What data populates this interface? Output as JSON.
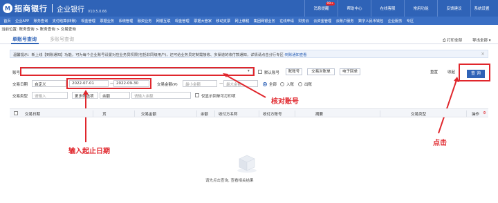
{
  "header": {
    "logo_mark": "M",
    "bank_name": "招商银行",
    "app_name": "企业银行",
    "version": "V10.5.0.66"
  },
  "util_links": [
    {
      "label": "消息提醒",
      "badge": "99+"
    },
    {
      "label": "帮助中心",
      "badge": ""
    },
    {
      "label": "在线客服",
      "badge": ""
    },
    {
      "label": "常用功能",
      "badge": ""
    },
    {
      "label": "反馈建议",
      "badge": ""
    },
    {
      "label": "系统设置",
      "badge": ""
    },
    {
      "label": "安全退出",
      "badge": ""
    }
  ],
  "nav": [
    "首页",
    "企业APP",
    "账务查询",
    "支付结算(转账)",
    "现金管理",
    "票据业务",
    "系统管理",
    "融资业务",
    "网银互联",
    "现金管理",
    "票据大管家",
    "移动支票",
    "网上缴税",
    "集团网银业务",
    "在线申请",
    "财务云",
    "云资金管理",
    "云账户服务",
    "数字人民币钱包",
    "企业服务",
    "专区",
    "购物"
  ],
  "breadcrumb": "当前位置: 账务查询 > 账务查询 > 交易查询",
  "tabs": {
    "active": "单账号查询",
    "inactive": "多账号查询"
  },
  "print_all": "打印全部",
  "export_all": "导出全部",
  "notice": {
    "prefix": "温馨提示：",
    "text": "新上线【到账通知】功能，可为每个企业账号设置对应业务员权限(包括非同级用户)，还可给业务员定制需接收、多渠道的收付款通知，详情请点击分行专区-",
    "link": "到账通知查看"
  },
  "form": {
    "account_label": "账号",
    "account_value": "",
    "default_account_label": "默认账号",
    "account_number_btn": "账账号",
    "trade_account_btn": "交易对账单",
    "e_receipt_btn": "电子回单",
    "date_label": "交易日期",
    "date_mode": "自定义",
    "date_start": "2022-07-01",
    "date_to": "—",
    "date_end": "2022-09-30",
    "amount_label": "交易金额(¥)",
    "amount_min_placeholder": "最小金额",
    "amount_dash": "—",
    "amount_max_placeholder": "最大金额",
    "direction_all": "全部",
    "direction_in": "入账",
    "direction_out": "出账",
    "trade_type_label": "交易类型",
    "trade_type_placeholder": "请输入",
    "more_filter": "更多筛选项",
    "balance_label": "余额",
    "balance_placeholder": "请输入余额",
    "show_printable": "仅显示回单可打印项",
    "reset": "重置",
    "collapse": "收起",
    "query": "查 询"
  },
  "annotations": {
    "date_hint": "输入起止日期",
    "account_hint": "核对账号",
    "click_hint": "点击"
  },
  "table": {
    "columns": [
      "交易日期",
      "货",
      "交易金额",
      "余额",
      "收付方名称",
      "收付方账号",
      "摘要",
      "交易类型",
      "操作"
    ]
  },
  "empty": {
    "message": "请先点击查询, 查看相关结果"
  },
  "colors": {
    "brand": "#2f63b7",
    "annotation": "#e0262c"
  }
}
